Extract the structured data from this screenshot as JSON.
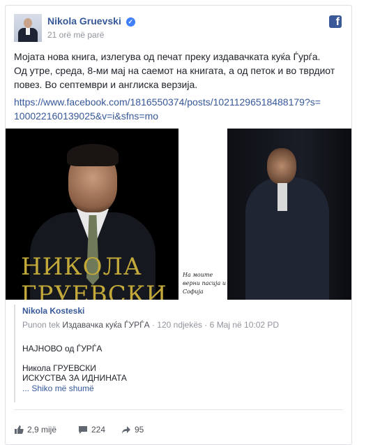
{
  "post": {
    "author": "Nikola Gruevski",
    "verified_icon": "verified-badge-icon",
    "time": "21 orë më parë",
    "text_line1": "Мојата нова книга, излегува од печат преку издавачката куќа Ѓурѓа.",
    "text_line2": "Од утре, среда, 8-ми мај на саемот на книгата, а од петок и во тврдиот повез. Во септември и англиска верзија.",
    "link": "https://www.facebook.com/1816550374/posts/10211296518488179?s=100022160139025&v=i&sfns=mo",
    "brand_icon": "facebook-logo-icon"
  },
  "images": {
    "left_title_line1": "НИКОЛА",
    "left_title_line2": "ГРУЕВСКИ",
    "right_caption": "На моите верни пасија и Софија"
  },
  "shared": {
    "name": "Nikola Kosteski",
    "meta_prefix": "Punon tek",
    "meta_place": "Издавачка куќа ЃУРЃА",
    "meta_suffix": "· 120 ndjekës · 6 Maj në 10:02 PD",
    "line1": "НАЈНОВО од ЃУРЃА",
    "line2": "Никола ГРУЕВСКИ",
    "line3": "ИСКУСТВА ЗА ИДНИНАТА",
    "see_more": "... Shiko më shumë"
  },
  "actions": {
    "likes": "2,9 mijë",
    "comments": "224",
    "shares": "95"
  },
  "colors": {
    "link": "#365899",
    "muted": "#90949c",
    "text": "#1d2129",
    "gold_title": "#c3a93a"
  }
}
